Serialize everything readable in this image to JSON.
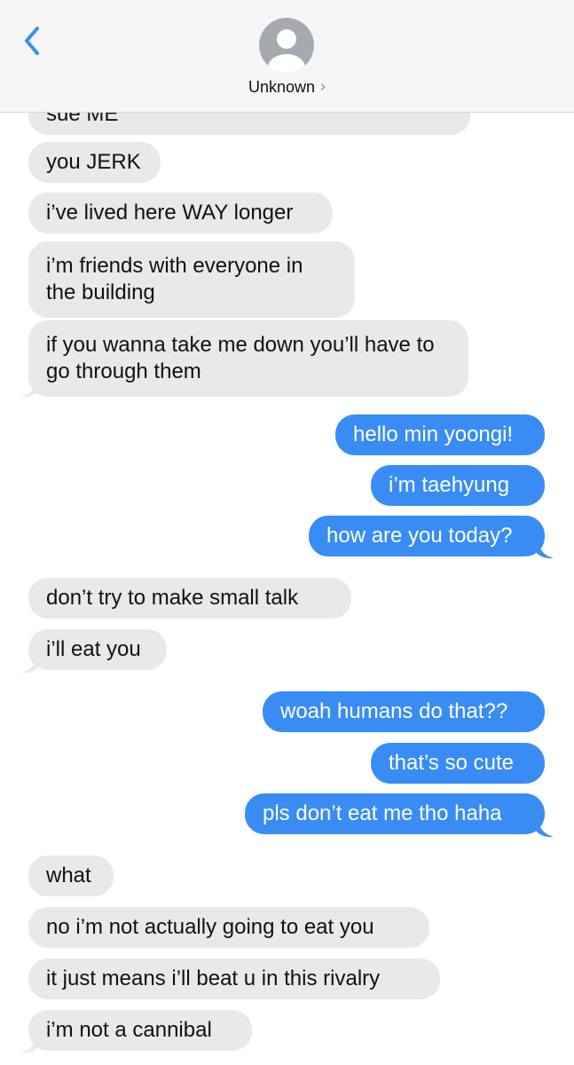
{
  "header": {
    "contact_name": "Unknown",
    "chevron": "›",
    "back_icon": "chevron-left-icon",
    "avatar_icon": "person-silhouette-icon",
    "accent_color": "#3a8cf5"
  },
  "messages": [
    {
      "from": "them",
      "text": "sue ME"
    },
    {
      "from": "them",
      "text": "you JERK"
    },
    {
      "from": "them",
      "text": "i’ve lived here WAY longer"
    },
    {
      "from": "them",
      "text": "i’m friends with everyone in the building"
    },
    {
      "from": "them",
      "text": "if you wanna take me down you’ll have to go through them"
    },
    {
      "from": "me",
      "text": "hello min yoongi!"
    },
    {
      "from": "me",
      "text": "i’m taehyung"
    },
    {
      "from": "me",
      "text": "how are you today?"
    },
    {
      "from": "them",
      "text": "don’t try to make small talk"
    },
    {
      "from": "them",
      "text": "i’ll eat you"
    },
    {
      "from": "me",
      "text": "woah humans do that??"
    },
    {
      "from": "me",
      "text": "that’s so cute"
    },
    {
      "from": "me",
      "text": "pls don’t eat me tho haha"
    },
    {
      "from": "them",
      "text": "what"
    },
    {
      "from": "them",
      "text": "no i’m not actually going to eat you"
    },
    {
      "from": "them",
      "text": "it just means i’ll beat u in this rivalry"
    },
    {
      "from": "them",
      "text": "i’m not a cannibal"
    }
  ],
  "colors": {
    "received_bubble": "#e9e9eb",
    "sent_bubble": "#3a8cf5"
  }
}
